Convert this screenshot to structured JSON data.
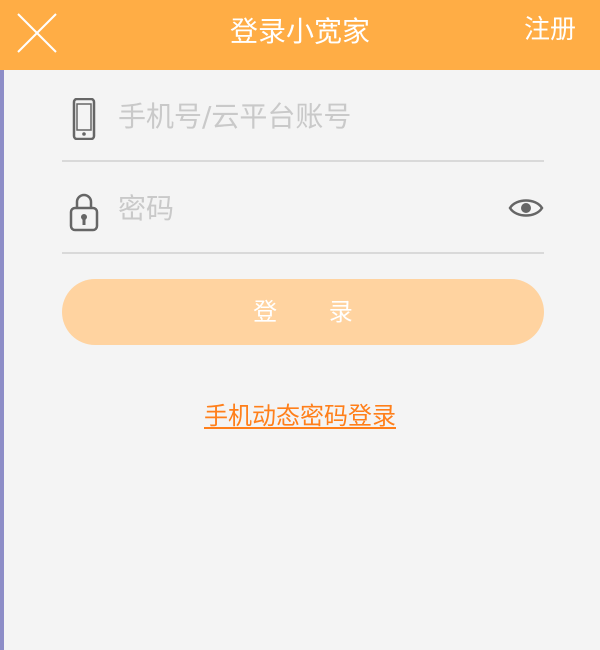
{
  "header": {
    "title": "登录小宽家",
    "register_label": "注册"
  },
  "form": {
    "phone_placeholder": "手机号/云平台账号",
    "phone_value": "",
    "password_placeholder": "密码",
    "password_value": ""
  },
  "actions": {
    "login_label": "登 录",
    "sms_login_label": "手机动态密码登录"
  },
  "colors": {
    "header_bg": "#ffad45",
    "login_button_bg": "#ffd3a0",
    "link": "#ff7f1a",
    "page_bg": "#f4f4f4"
  },
  "icons": {
    "close": "close-icon",
    "phone": "mobile-phone-icon",
    "lock": "lock-icon",
    "eye": "eye-icon"
  }
}
